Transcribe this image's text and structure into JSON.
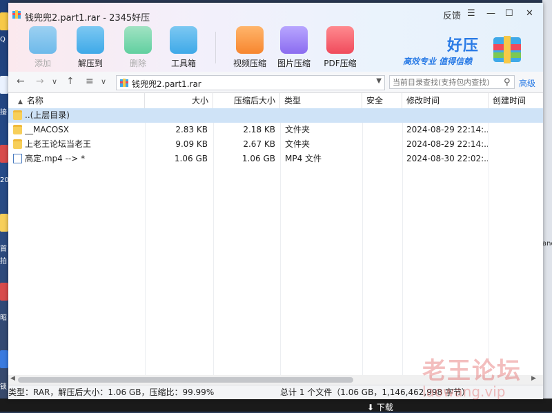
{
  "window": {
    "title": "钱兜兜2.part1.rar - 2345好压",
    "feedback": "反馈",
    "menu_glyph": "☰",
    "minimize_glyph": "—",
    "maximize_glyph": "☐",
    "close_glyph": "✕"
  },
  "toolbar": {
    "items": [
      {
        "label": "添加",
        "icon": "add-archive-icon",
        "color": "#3fa9e8",
        "disabled": true
      },
      {
        "label": "解压到",
        "icon": "extract-icon",
        "color": "#3fa9e8",
        "disabled": false
      },
      {
        "label": "删除",
        "icon": "recycle-icon",
        "color": "#3cc88a",
        "disabled": true
      },
      {
        "label": "工具箱",
        "icon": "toolbox-icon",
        "color": "#3fa9e8",
        "disabled": false
      },
      {
        "label": "视频压缩",
        "icon": "video-compress-icon",
        "color": "#f7862f",
        "disabled": false
      },
      {
        "label": "图片压缩",
        "icon": "image-compress-icon",
        "color": "#8b6cf0",
        "disabled": false
      },
      {
        "label": "PDF压缩",
        "icon": "pdf-compress-icon",
        "color": "#f04b5c",
        "disabled": false
      }
    ]
  },
  "brand": {
    "name": "好压",
    "slogan": "高效专业  值得信赖"
  },
  "nav": {
    "back": "←",
    "forward": "→",
    "dropdown": "∨",
    "up": "↑",
    "view": "≡",
    "view_dropdown": "∨",
    "path": "钱兜兜2.part1.rar",
    "path_dropdown": "▼",
    "search_placeholder": "当前目录查找(支持包内查找)",
    "search_glyph": "⚲",
    "advanced": "高级"
  },
  "columns": {
    "name": "名称",
    "size": "大小",
    "packed": "压缩后大小",
    "type": "类型",
    "security": "安全",
    "modified": "修改时间",
    "created": "创建时间",
    "sort_glyph": "▲"
  },
  "rows": [
    {
      "name": "..(上层目录)",
      "size": "",
      "packed": "",
      "type": "",
      "modified": "",
      "kind": "folder"
    },
    {
      "name": "__MACOSX",
      "size": "2.83 KB",
      "packed": "2.18 KB",
      "type": "文件夹",
      "modified": "2024-08-29 22:14:...",
      "kind": "folder"
    },
    {
      "name": "上老王论坛当老王",
      "size": "9.09 KB",
      "packed": "2.67 KB",
      "type": "文件夹",
      "modified": "2024-08-29 22:14:...",
      "kind": "folder"
    },
    {
      "name": "高定.mp4 --> *",
      "size": "1.06 GB",
      "packed": "1.06 GB",
      "type": "MP4 文件",
      "modified": "2024-08-30 22:02:...",
      "kind": "file"
    }
  ],
  "status": {
    "left": "类型：RAR，解压后大小：1.06 GB，压缩比：99.99%",
    "right": "总计 1 个文件（1.06 GB，1,146,462,998 字节）"
  },
  "scroll": {
    "left": "◀",
    "right": "▶"
  },
  "watermark": {
    "text": "老王论坛",
    "url": "laowang.vip"
  },
  "desktop": {
    "left_labels": [
      "Q",
      "接",
      "20",
      "首",
      "拍",
      "昭",
      "锁"
    ],
    "right_label": "and",
    "taskbar_download": "⬇ 下载"
  }
}
